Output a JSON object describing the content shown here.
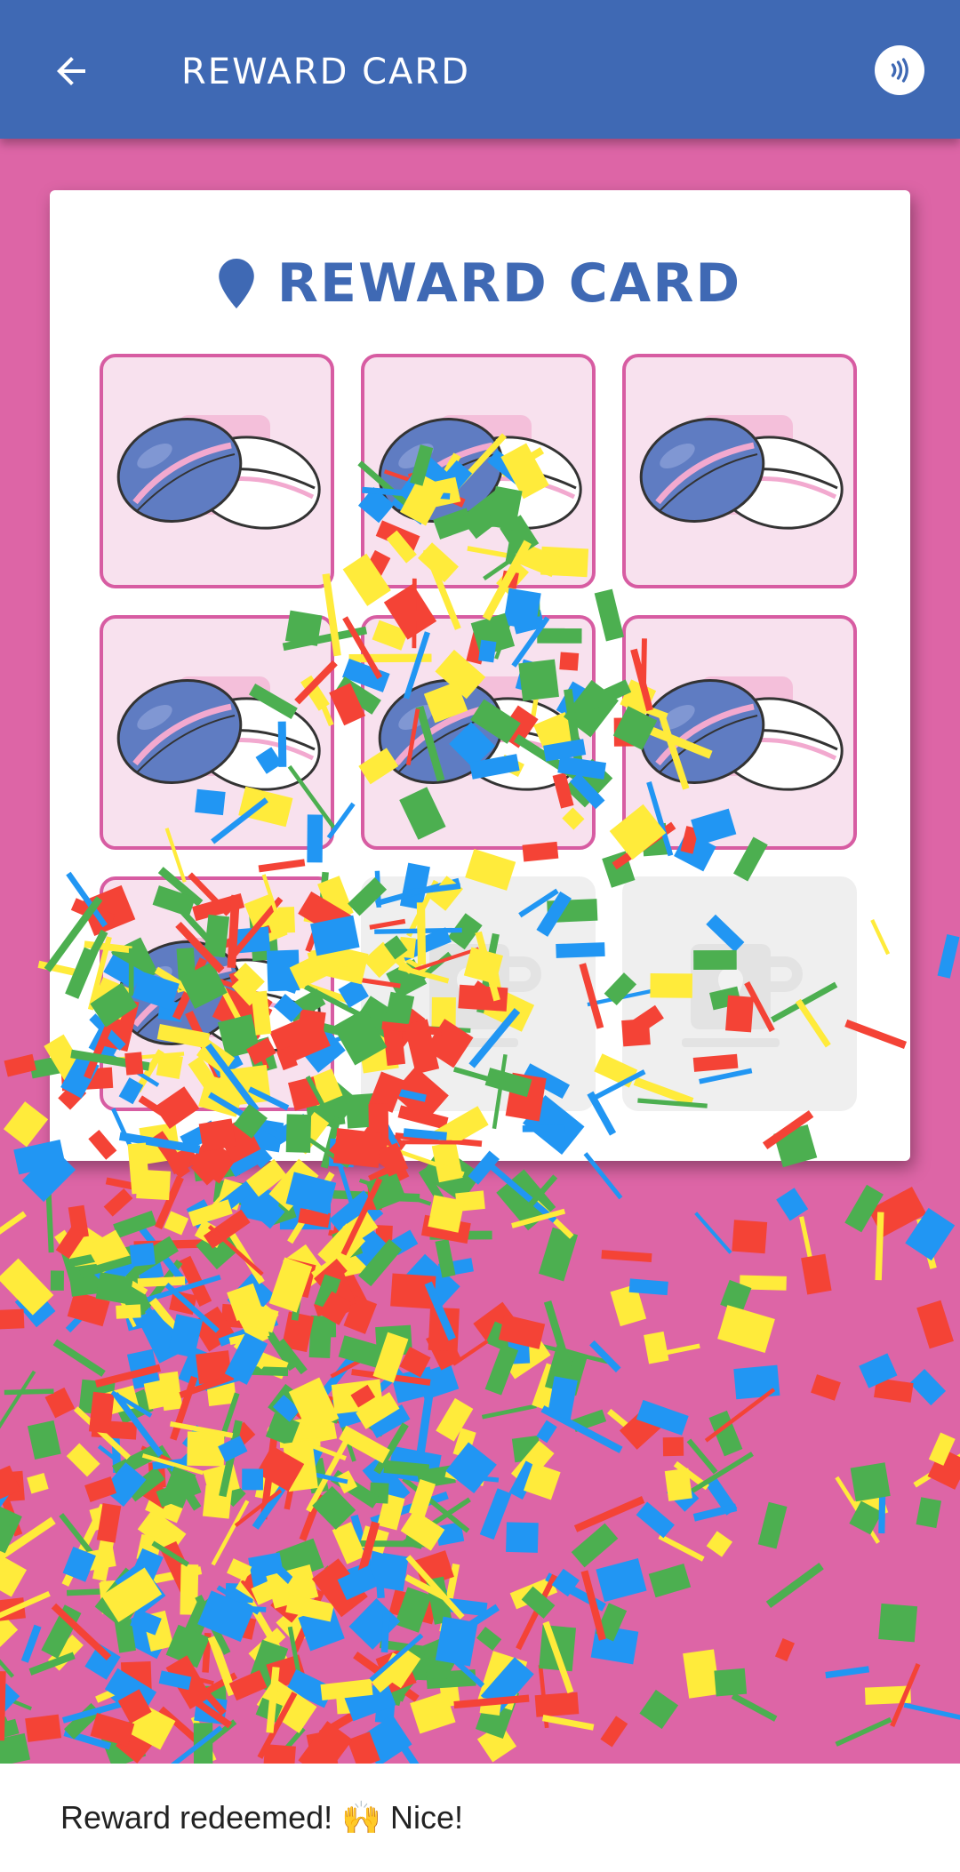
{
  "appbar": {
    "title": "REWARD CARD",
    "back_icon": "arrow-back-icon",
    "nfc_icon": "nfc-contactless-icon"
  },
  "card": {
    "title": "REWARD CARD",
    "pin_icon": "location-pin-icon",
    "stamps": [
      {
        "state": "stamped"
      },
      {
        "state": "stamped"
      },
      {
        "state": "stamped"
      },
      {
        "state": "stamped"
      },
      {
        "state": "stamped"
      },
      {
        "state": "stamped"
      },
      {
        "state": "stamped"
      },
      {
        "state": "empty"
      },
      {
        "state": "empty"
      }
    ],
    "stamp_icon": "coffee-beans-icon",
    "empty_icon": "coffee-cup-icon"
  },
  "confetti": {
    "colors": [
      "#F44336",
      "#2196F3",
      "#FFEB3B",
      "#4CAF50"
    ]
  },
  "snackbar": {
    "message": "Reward redeemed! 🙌 Nice!"
  },
  "colors": {
    "primary": "#3F69B4",
    "background": "#DD65A6",
    "stamp_border": "#D75CA2",
    "stamp_fill": "#F8E1EE"
  }
}
